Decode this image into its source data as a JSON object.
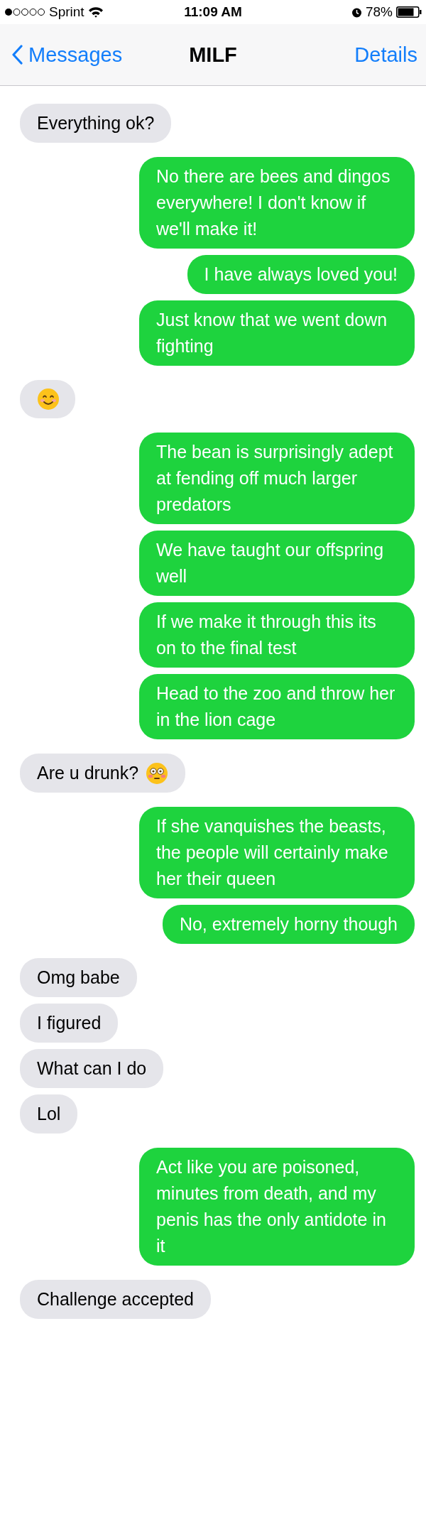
{
  "status_bar": {
    "carrier": "Sprint",
    "time": "11:09 AM",
    "battery": "78%"
  },
  "nav": {
    "back": "Messages",
    "title": "MILF",
    "action": "Details"
  },
  "messages": [
    {
      "kind": "received",
      "text": "Everything ok?"
    },
    {
      "kind": "sent",
      "text": "No there are bees and dingos everywhere! I don't know if we'll make it!"
    },
    {
      "kind": "sent",
      "text": "I have always loved you!"
    },
    {
      "kind": "sent",
      "text": "Just know that we went down fighting"
    },
    {
      "kind": "emoji"
    },
    {
      "kind": "sent",
      "text": "The bean is surprisingly adept at fending off much larger predators"
    },
    {
      "kind": "sent",
      "text": "We have taught our offspring well"
    },
    {
      "kind": "sent",
      "text": "If we make it through this its on to the final test"
    },
    {
      "kind": "sent",
      "text": "Head to the zoo and throw her in the lion cage"
    },
    {
      "kind": "received",
      "text": "Are u drunk?"
    },
    {
      "kind": "sent",
      "text": "If she vanquishes the beasts, the people will certainly make her their queen"
    },
    {
      "kind": "sent",
      "text": "No, extremely horny though"
    },
    {
      "kind": "received",
      "text": "Omg babe"
    },
    {
      "kind": "received",
      "text": "I figured"
    },
    {
      "kind": "received",
      "text": "What can I do"
    },
    {
      "kind": "received",
      "text": "Lol"
    },
    {
      "kind": "sent",
      "text": "Act like you are poisoned, minutes from death, and my penis has the only antidote in it"
    },
    {
      "kind": "received",
      "text": "Challenge accepted"
    }
  ]
}
